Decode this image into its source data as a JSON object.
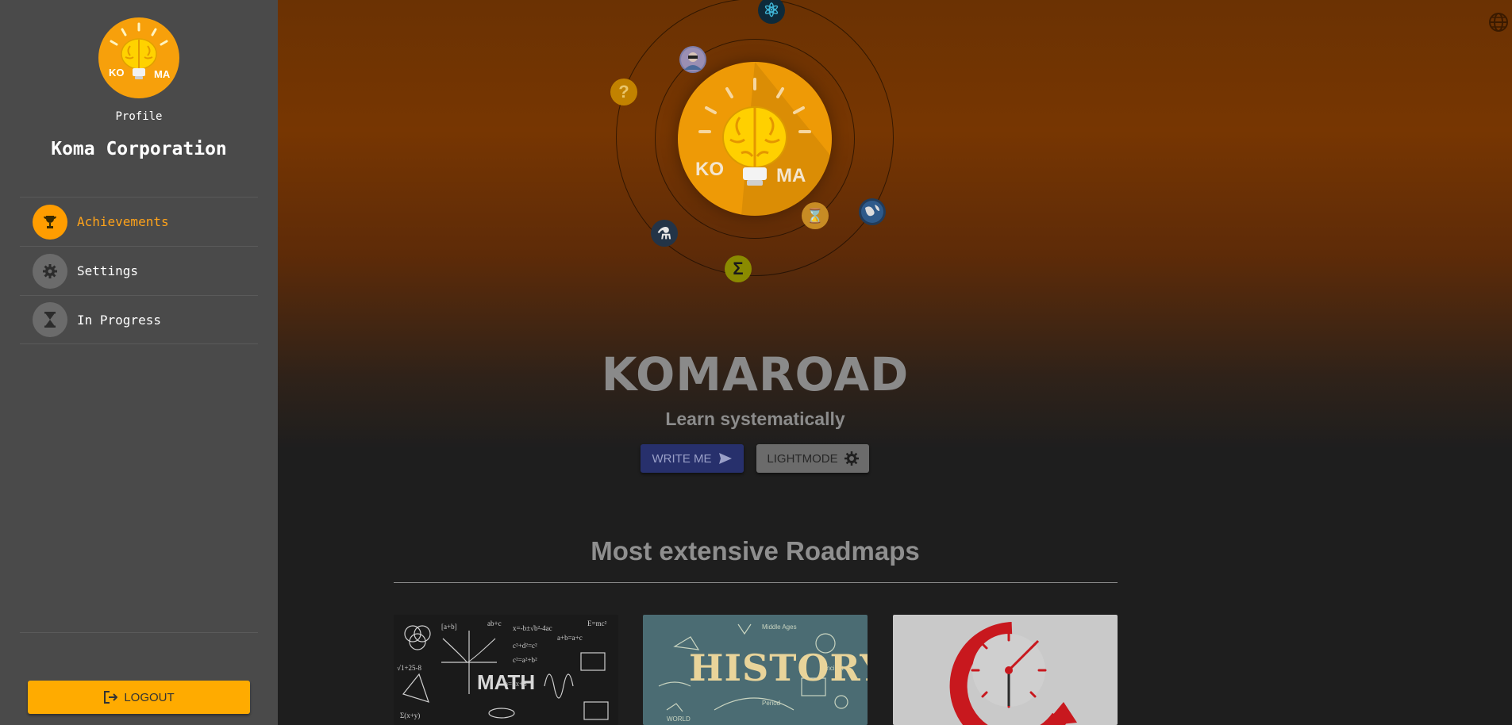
{
  "sidebar": {
    "avatar_text_left": "KO",
    "avatar_text_right": "MA",
    "profile_label": "Profile",
    "org_name": "Koma Corporation",
    "items": [
      {
        "label": "Achievements",
        "icon": "trophy-icon",
        "active": true
      },
      {
        "label": "Settings",
        "icon": "gear-icon",
        "active": false
      },
      {
        "label": "In Progress",
        "icon": "hourglass-icon",
        "active": false
      }
    ],
    "logout_label": "LOGOUT"
  },
  "hero": {
    "logo_text_left": "KO",
    "logo_text_right": "MA",
    "title": "KOMAROAD",
    "subtitle": "Learn systematically",
    "write_label": "WRITE ME",
    "lightmode_label": "LIGHTMODE"
  },
  "orbit_planets": [
    {
      "name": "react-icon",
      "glyph": "⚛"
    },
    {
      "name": "user-avatar-icon",
      "glyph": ""
    },
    {
      "name": "question-icon",
      "glyph": "?"
    },
    {
      "name": "flask-icon",
      "glyph": "⚗"
    },
    {
      "name": "sigma-icon",
      "glyph": "Σ"
    },
    {
      "name": "hourglass-planet-icon",
      "glyph": "⌛"
    },
    {
      "name": "globe-planet-icon",
      "glyph": "◉"
    }
  ],
  "roadmaps": {
    "section_title": "Most extensive Roadmaps",
    "cards": [
      {
        "name": "math",
        "caption": "MATH"
      },
      {
        "name": "history",
        "caption": "HISTORY"
      },
      {
        "name": "time",
        "caption": ""
      }
    ]
  },
  "colors": {
    "accent": "#ffab00",
    "active_text": "#ffa31a",
    "sidebar_bg": "#4a4a4a",
    "write_btn": "#27306c"
  }
}
